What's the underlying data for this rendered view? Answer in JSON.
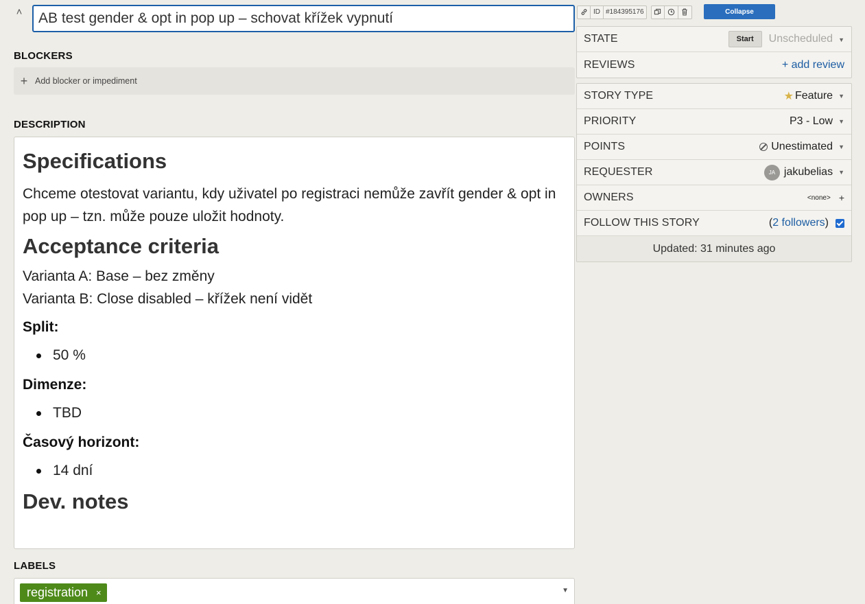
{
  "story": {
    "title": "AB test gender & opt in pop up – schovat křížek vypnutí"
  },
  "sections": {
    "blockers": "BLOCKERS",
    "description": "DESCRIPTION",
    "labels": "LABELS"
  },
  "blockers": {
    "add_text": "Add blocker or impediment"
  },
  "description": {
    "h_spec": "Specifications",
    "spec_text": "Chceme otestovat variantu, kdy uživatel po registraci nemůže zavřít gender & opt in pop up – tzn. může pouze uložit hodnoty.",
    "h_accept": "Acceptance criteria",
    "varianta_a": "Varianta A: Base – bez změny",
    "varianta_b": "Varianta B: Close disabled – křížek není vidět",
    "split_label": "Split:",
    "split_items": [
      "50 %"
    ],
    "dimenze_label": "Dimenze:",
    "dimenze_items": [
      "TBD"
    ],
    "horizont_label": "Časový horizont:",
    "horizont_items": [
      "14 dní"
    ],
    "h_dev": "Dev. notes"
  },
  "labels": {
    "items": [
      "registration"
    ],
    "remove_glyph": "×"
  },
  "toolbar": {
    "id_label": "ID",
    "id_value": "#184395176",
    "collapse_label": "Collapse"
  },
  "state": {
    "label": "STATE",
    "start_button": "Start",
    "value": "Unscheduled"
  },
  "reviews": {
    "label": "REVIEWS",
    "add_link": "+ add review"
  },
  "details": {
    "story_type_label": "STORY TYPE",
    "story_type_value": "Feature",
    "priority_label": "PRIORITY",
    "priority_value": "P3 - Low",
    "points_label": "POINTS",
    "points_value": "Unestimated",
    "requester_label": "REQUESTER",
    "requester_initials": "JA",
    "requester_value": "jakubelias",
    "owners_label": "OWNERS",
    "owners_value": "<none>",
    "follow_label": "FOLLOW THIS STORY",
    "followers_link": "2 followers",
    "updated_text": "Updated: 31 minutes ago"
  },
  "colors": {
    "accent": "#2a6ebd",
    "label_chip": "#4e8a1a",
    "star": "#d8b349",
    "background": "#eeede7"
  },
  "icons": {
    "caret": "chevron-up-icon",
    "link": "link-icon",
    "clone": "clone-icon",
    "history": "history-icon",
    "delete": "trash-icon",
    "star": "star-icon",
    "estimate": "unestimated-icon"
  }
}
